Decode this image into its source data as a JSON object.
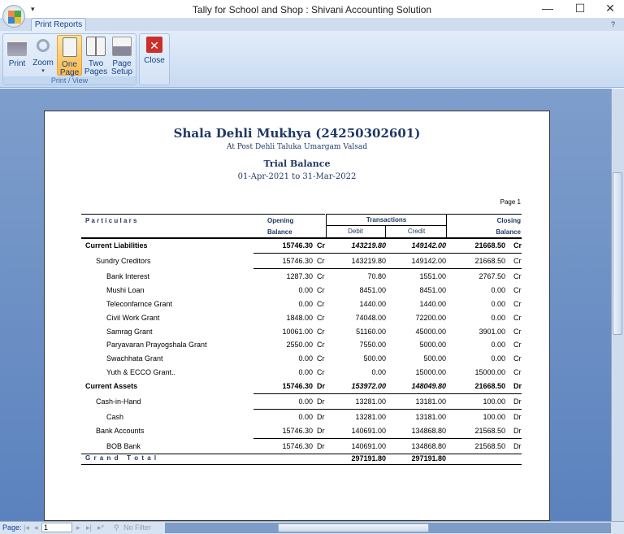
{
  "window": {
    "title": "Tally for School and Shop : Shivani Accounting Solution",
    "minimize": "—",
    "maximize": "☐",
    "close": "✕"
  },
  "ribbon": {
    "tab": "Print Reports",
    "quick_access": "▾",
    "help": "?",
    "groups": [
      {
        "label": "Print / View"
      }
    ],
    "buttons": {
      "print": "Print",
      "zoom": "Zoom",
      "zoom_arrow": "▾",
      "one_page": "One\nPage",
      "two_pages": "Two\nPages",
      "page_setup": "Page\nSetup",
      "close": "Close"
    }
  },
  "report": {
    "org": "Shala Dehli Mukhya (24250302601)",
    "address": "At Post Dehli Taluka Umargam Valsad",
    "title": "Trial Balance",
    "period": "01-Apr-2021 to 31-Mar-2022",
    "page": "Page 1",
    "headers": {
      "particulars": "P a r t i c u l a r s",
      "opening": "Opening",
      "opening2": "Balance",
      "transactions": "Transactions",
      "debit": "Debit",
      "credit": "Credit",
      "closing": "Closing",
      "closing2": "Balance"
    },
    "rows": [
      {
        "name": "Current Liabilities",
        "opening": "15746.30",
        "ob_dc": "Cr",
        "debit": "143219.80",
        "credit": "149142.00",
        "closing": "21668.50",
        "cb_dc": "Cr",
        "level": 0
      },
      {
        "name": "Sundry Creditors",
        "opening": "15746.30",
        "ob_dc": "Cr",
        "debit": "143219.80",
        "credit": "149142.00",
        "closing": "21668.50",
        "cb_dc": "Cr",
        "level": 1
      },
      {
        "name": "Bank Interest",
        "opening": "1287.30",
        "ob_dc": "Cr",
        "debit": "70.80",
        "credit": "1551.00",
        "closing": "2767.50",
        "cb_dc": "Cr",
        "level": 2
      },
      {
        "name": "Mushi Loan",
        "opening": "0.00",
        "ob_dc": "Cr",
        "debit": "8451.00",
        "credit": "8451.00",
        "closing": "0.00",
        "cb_dc": "Cr",
        "level": 2
      },
      {
        "name": "Teleconfarnce Grant",
        "opening": "0.00",
        "ob_dc": "Cr",
        "debit": "1440.00",
        "credit": "1440.00",
        "closing": "0.00",
        "cb_dc": "Cr",
        "level": 2
      },
      {
        "name": "Civil Work Grant",
        "opening": "1848.00",
        "ob_dc": "Cr",
        "debit": "74048.00",
        "credit": "72200.00",
        "closing": "0.00",
        "cb_dc": "Cr",
        "level": 2
      },
      {
        "name": "Samrag Grant",
        "opening": "10061.00",
        "ob_dc": "Cr",
        "debit": "51160.00",
        "credit": "45000.00",
        "closing": "3901.00",
        "cb_dc": "Cr",
        "level": 2
      },
      {
        "name": "Paryavaran Prayogshala Grant",
        "opening": "2550.00",
        "ob_dc": "Cr",
        "debit": "7550.00",
        "credit": "5000.00",
        "closing": "0.00",
        "cb_dc": "Cr",
        "level": 2
      },
      {
        "name": "Swachhata Grant",
        "opening": "0.00",
        "ob_dc": "Cr",
        "debit": "500.00",
        "credit": "500.00",
        "closing": "0.00",
        "cb_dc": "Cr",
        "level": 2
      },
      {
        "name": "Yuth & ECCO Grant..",
        "opening": "0.00",
        "ob_dc": "Cr",
        "debit": "0.00",
        "credit": "15000.00",
        "closing": "15000.00",
        "cb_dc": "Cr",
        "level": 2
      },
      {
        "name": "Current Assets",
        "opening": "15746.30",
        "ob_dc": "Dr",
        "debit": "153972.00",
        "credit": "148049.80",
        "closing": "21668.50",
        "cb_dc": "Dr",
        "level": 0
      },
      {
        "name": "Cash-in-Hand",
        "opening": "0.00",
        "ob_dc": "Dr",
        "debit": "13281.00",
        "credit": "13181.00",
        "closing": "100.00",
        "cb_dc": "Dr",
        "level": 1
      },
      {
        "name": "Cash",
        "opening": "0.00",
        "ob_dc": "Dr",
        "debit": "13281.00",
        "credit": "13181.00",
        "closing": "100.00",
        "cb_dc": "Dr",
        "level": 2
      },
      {
        "name": "Bank Accounts",
        "opening": "15746.30",
        "ob_dc": "Dr",
        "debit": "140691.00",
        "credit": "134868.80",
        "closing": "21568.50",
        "cb_dc": "Dr",
        "level": 1
      },
      {
        "name": "BOB Bank",
        "opening": "15746.30",
        "ob_dc": "Dr",
        "debit": "140691.00",
        "credit": "134868.80",
        "closing": "21568.50",
        "cb_dc": "Dr",
        "level": 2
      }
    ],
    "grand_total": {
      "label": "G r a n d   T o t a l",
      "debit": "297191.80",
      "credit": "297191.80"
    }
  },
  "statusbar": {
    "page_label": "Page:",
    "page_value": "1",
    "filter": "No Filter",
    "nav_first": "|◂",
    "nav_prev": "◂",
    "nav_next": "▸",
    "nav_last": "▸|",
    "nav_new": "▸*"
  }
}
